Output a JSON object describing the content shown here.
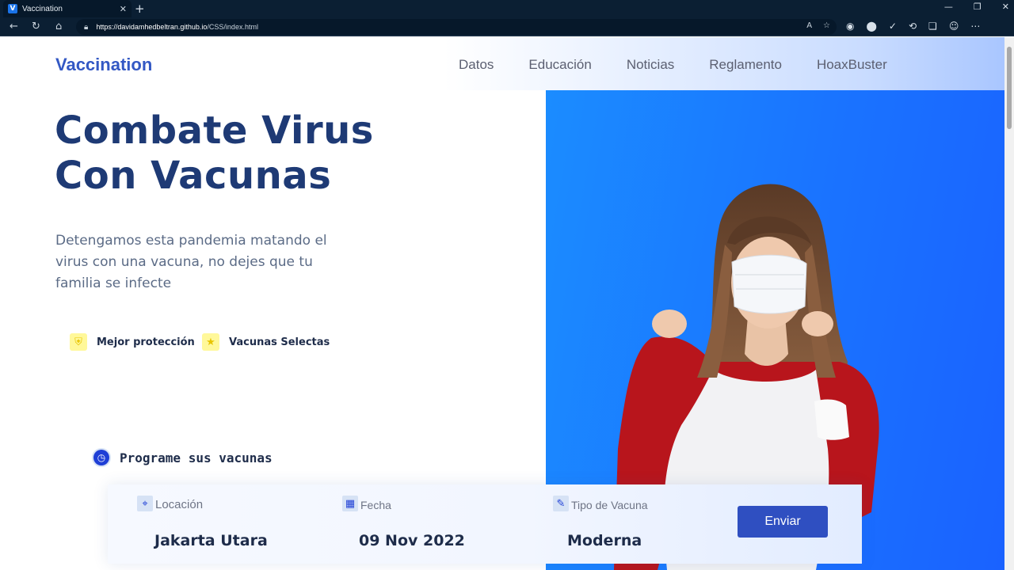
{
  "browser": {
    "tab_title": "Vaccination",
    "tab_favicon_letter": "V",
    "url_host": "https://davidamhedbeltran.github.io",
    "url_path": "/CSS/index.html"
  },
  "site": {
    "brand": "Vaccination",
    "nav": [
      "Datos",
      "Educación",
      "Noticias",
      "Reglamento",
      "HoaxBuster"
    ]
  },
  "hero": {
    "headline_line1": "Combate Virus",
    "headline_line2": "Con Vacunas",
    "lead": "Detengamos esta pandemia matando el virus con una vacuna, no dejes que tu familia se infecte",
    "features": [
      {
        "icon": "shield-icon",
        "label": "Mejor protección"
      },
      {
        "icon": "star-icon",
        "label": "Vacunas Selectas"
      }
    ]
  },
  "schedule": {
    "title": "Programe sus vacunas",
    "fields": [
      {
        "icon": "map-icon",
        "label": "Locación",
        "value": "Jakarta Utara"
      },
      {
        "icon": "calendar-icon",
        "label": "Fecha",
        "value": "09 Nov 2022"
      },
      {
        "icon": "syringe-icon",
        "label": "Tipo de Vacuna",
        "value": "Moderna"
      }
    ],
    "submit_label": "Enviar"
  },
  "colors": {
    "brand": "#3358c4",
    "headline": "#1e3a75",
    "hero_blue": "#1a73ff",
    "button": "#2f4fc1"
  }
}
